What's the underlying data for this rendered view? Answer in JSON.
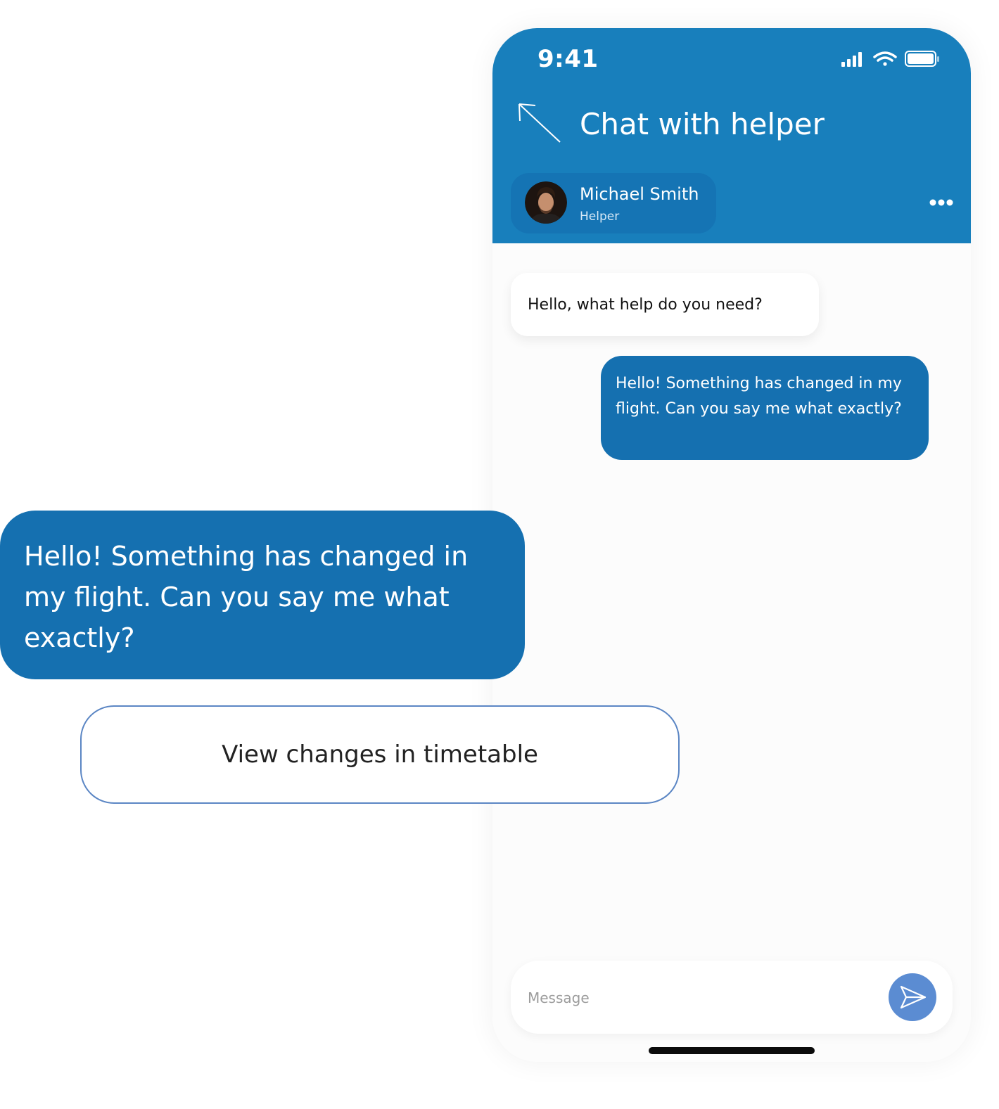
{
  "status_bar": {
    "time": "9:41"
  },
  "header": {
    "title": "Chat with helper",
    "contact": {
      "name": "Michael Smith",
      "role": "Helper"
    }
  },
  "messages": [
    {
      "from": "helper",
      "text": "Hello, what help do you need?"
    },
    {
      "from": "user",
      "text": "Hello! Something has changed in my flight. Can you say me what exactly?"
    }
  ],
  "composer": {
    "placeholder": "Message"
  },
  "callout": {
    "message": "Hello! Something has changed in my flight. Can you say me what exactly?",
    "button_label": "View changes in timetable"
  },
  "colors": {
    "header_blue": "#187fbc",
    "bubble_blue": "#1570b0",
    "send_blue": "#5b8cd2",
    "button_border": "#5b86c4"
  },
  "icons": [
    "signal-icon",
    "wifi-icon",
    "battery-icon",
    "back-arrow-icon",
    "more-options-icon",
    "send-icon"
  ]
}
